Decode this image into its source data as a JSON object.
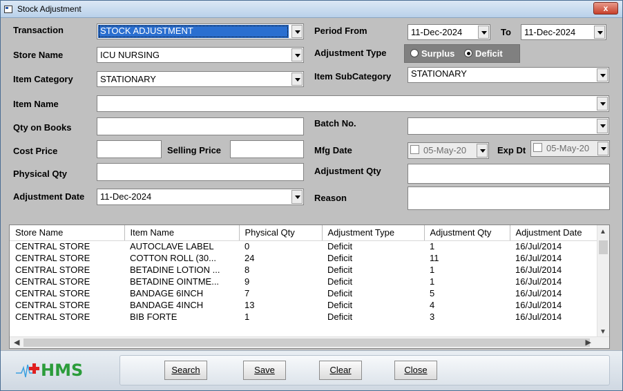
{
  "window": {
    "title": "Stock Adjustment",
    "close_label": "x"
  },
  "form": {
    "transaction": {
      "label": "Transaction",
      "value": "STOCK ADJUSTMENT"
    },
    "period_from": {
      "label": "Period From",
      "value": "11-Dec-2024"
    },
    "to": {
      "label": "To",
      "value": "11-Dec-2024"
    },
    "store_name": {
      "label": "Store Name",
      "value": "ICU NURSING"
    },
    "adjustment_type": {
      "label": "Adjustment Type",
      "options": [
        "Surplus",
        "Deficit"
      ],
      "selected": "Deficit"
    },
    "item_category": {
      "label": "Item Category",
      "value": "STATIONARY"
    },
    "item_subcategory": {
      "label": "Item SubCategory",
      "value": "STATIONARY"
    },
    "item_name": {
      "label": "Item Name",
      "value": ""
    },
    "qty_on_books": {
      "label": "Qty on Books",
      "value": ""
    },
    "batch_no": {
      "label": "Batch No.",
      "value": ""
    },
    "cost_price": {
      "label": "Cost Price",
      "value": ""
    },
    "selling_price": {
      "label": "Selling Price",
      "value": ""
    },
    "mfg_date": {
      "label": "Mfg Date",
      "value": "05-May-20"
    },
    "exp_dt": {
      "label": "Exp Dt",
      "value": "05-May-20"
    },
    "physical_qty": {
      "label": "Physical Qty",
      "value": ""
    },
    "adjustment_qty": {
      "label": "Adjustment Qty",
      "value": ""
    },
    "adjustment_date": {
      "label": "Adjustment Date",
      "value": "11-Dec-2024"
    },
    "reason": {
      "label": "Reason",
      "value": ""
    }
  },
  "grid": {
    "columns": [
      "Store Name",
      "Item Name",
      "Physical Qty",
      "Adjustment Type",
      "Adjustment Qty",
      "Adjustment Date"
    ],
    "rows": [
      [
        "CENTRAL STORE",
        "AUTOCLAVE LABEL",
        "0",
        "Deficit",
        "1",
        "16/Jul/2014"
      ],
      [
        "CENTRAL STORE",
        "COTTON ROLL (30...",
        "24",
        "Deficit",
        "11",
        "16/Jul/2014"
      ],
      [
        "CENTRAL STORE",
        "BETADINE LOTION ...",
        "8",
        "Deficit",
        "1",
        "16/Jul/2014"
      ],
      [
        "CENTRAL STORE",
        "BETADINE OINTME...",
        "9",
        "Deficit",
        "1",
        "16/Jul/2014"
      ],
      [
        "CENTRAL STORE",
        "BANDAGE 6INCH",
        "7",
        "Deficit",
        "5",
        "16/Jul/2014"
      ],
      [
        "CENTRAL STORE",
        "BANDAGE 4INCH",
        "13",
        "Deficit",
        "4",
        "16/Jul/2014"
      ],
      [
        "CENTRAL STORE",
        "BIB FORTE",
        "1",
        "Deficit",
        "3",
        "16/Jul/2014"
      ]
    ]
  },
  "footer": {
    "logo_text": "HMS",
    "buttons": {
      "search": "Search",
      "save": "Save",
      "clear": "Clear",
      "close": "Close"
    }
  },
  "colors": {
    "accent": "#2b6fd0",
    "logo_green": "#2b9c3a",
    "logo_red": "#e02020"
  }
}
